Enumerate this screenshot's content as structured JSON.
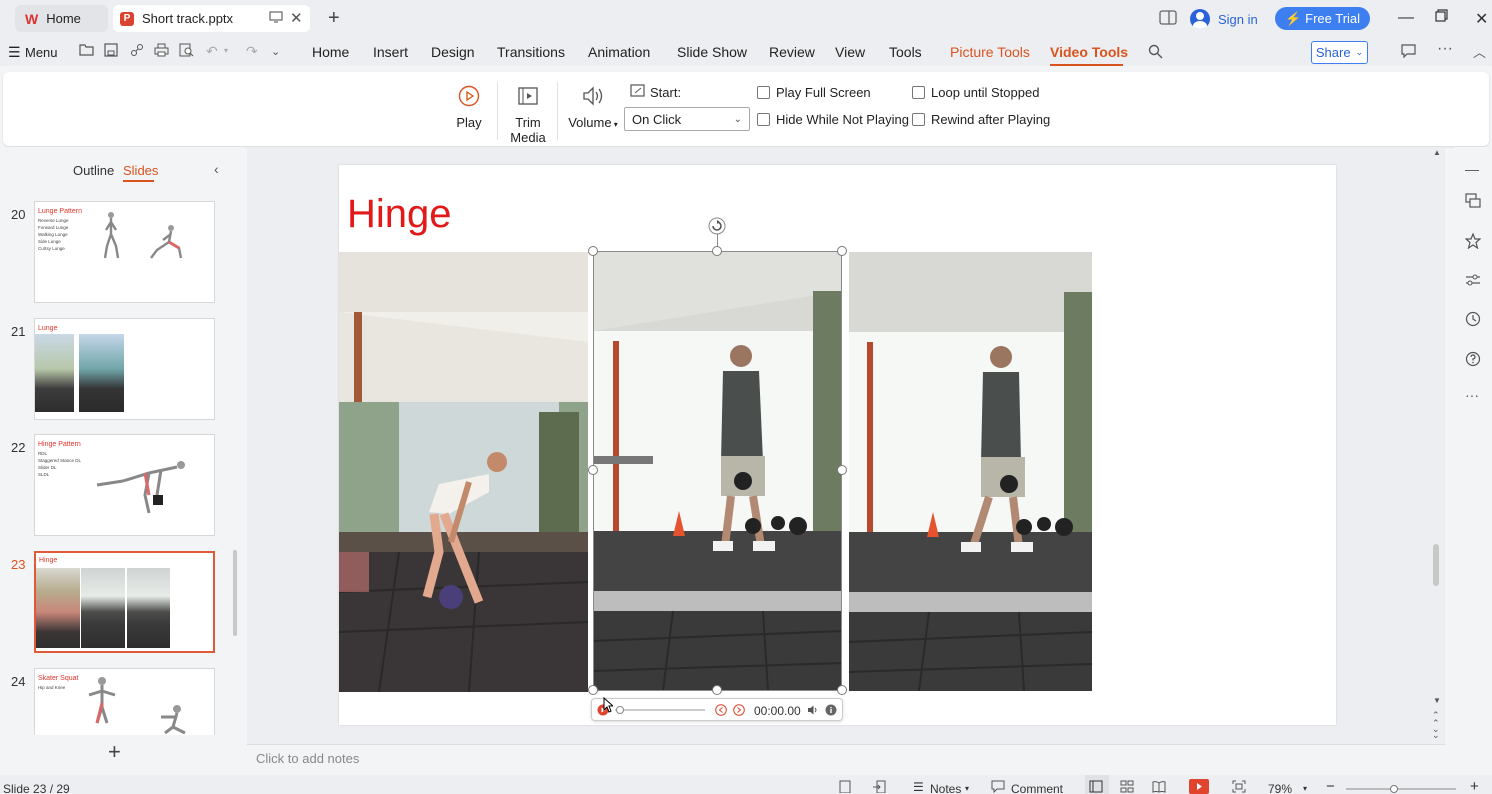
{
  "titlebar": {
    "home_tab": "Home",
    "doc_tab": "Short track.pptx",
    "sign_in": "Sign in",
    "free_trial": "Free Trial"
  },
  "menubar": {
    "menu_label": "Menu",
    "items": [
      "Home",
      "Insert",
      "Design",
      "Transitions",
      "Animation",
      "Slide Show",
      "Review",
      "View",
      "Tools",
      "Picture Tools",
      "Video Tools"
    ],
    "share": "Share"
  },
  "ribbon": {
    "play": "Play",
    "trim_line1": "Trim",
    "trim_line2": "Media",
    "volume": "Volume",
    "start_label": "Start:",
    "start_value": "On Click",
    "play_full_screen": "Play Full Screen",
    "hide_while_not_playing": "Hide While Not Playing",
    "loop_until_stopped": "Loop until Stopped",
    "rewind_after_playing": "Rewind after Playing"
  },
  "leftpanel": {
    "outline_tab": "Outline",
    "slides_tab": "Slides",
    "thumbs": [
      {
        "num": "20",
        "title": "Lunge Pattern",
        "bullets": [
          "Reverse Lunge",
          "Forward Lunge",
          "Walking Lunge",
          "Side Lunge",
          "Curtsy Lunge"
        ]
      },
      {
        "num": "21",
        "title": "Lunge",
        "bullets": []
      },
      {
        "num": "22",
        "title": "Hinge Pattern",
        "bullets": [
          "RDL",
          "Staggered Stance DL",
          "Slider DL",
          "SLDL"
        ]
      },
      {
        "num": "23",
        "title": "Hinge",
        "bullets": []
      },
      {
        "num": "24",
        "title": "Skater Squat",
        "bullets": [
          "Hip and Knee"
        ]
      }
    ]
  },
  "slide": {
    "title": "Hinge",
    "media_time": "00:00.00"
  },
  "notes_placeholder": "Click to add notes",
  "statusbar": {
    "slide_indicator": "Slide 23 / 29",
    "notes": "Notes",
    "comment": "Comment",
    "zoom": "79%"
  },
  "colors": {
    "accent": "#d9531e",
    "title_red": "#e31919",
    "brand_blue": "#3d7ff0"
  }
}
